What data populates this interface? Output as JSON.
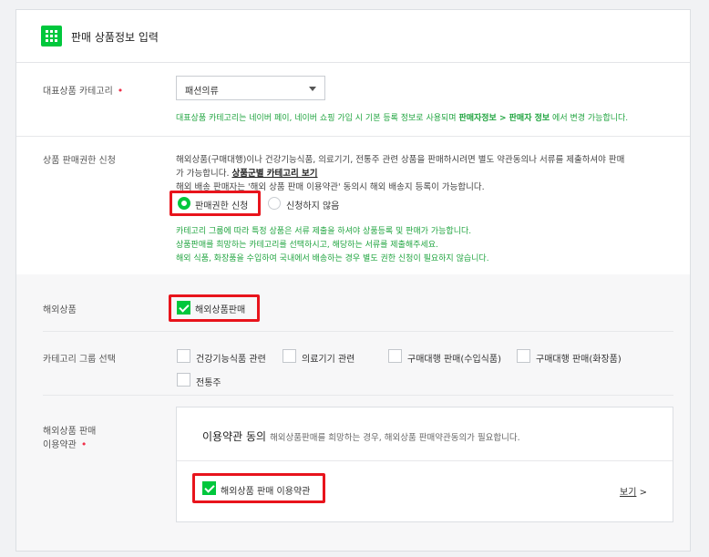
{
  "header": {
    "title": "판매 상품정보 입력",
    "icon": "grid-icon"
  },
  "category": {
    "label": "대표상품 카테고리",
    "required_mark": "•",
    "selected": "패션의류",
    "note_prefix": "대표상품 카테고리는 네이버 페이, 네이버 쇼핑 가입 시 기본 등록 정보로 사용되며 ",
    "note_bold": "판매자정보 > 판매자 정보",
    "note_suffix": " 에서 변경 가능합니다."
  },
  "permission": {
    "label": "상품 판매권한 신청",
    "desc_line1": "해외상품(구매대행)이나 건강기능식품, 의료기기, 전통주 관련 상품을 판매하시려면 별도 약관동의나 서류를 제출하셔야 판매",
    "desc_line2_prefix": "가 가능합니다. ",
    "desc_link": "상품군별 카테고리 보기",
    "desc_line3": "해외 배송 판매자는 '해외 상품 판매 이용약관' 동의시 해외 배송지 등록이 가능합니다.",
    "option_apply": "판매권한 신청",
    "option_no_apply": "신청하지 않음",
    "selected": "판매권한 신청",
    "note1": "카테고리 그룹에 따라 특정 상품은 서류 제출을 하셔야 상품등록 및 판매가 가능합니다.",
    "note2": "상품판매를 희망하는 카테고리를 선택하시고, 해당하는 서류를 제출해주세요.",
    "note3": "해외 식품, 화장품을 수입하여 국내에서 배송하는 경우 별도 권한 신청이 필요하지 않습니다."
  },
  "overseas": {
    "label": "해외상품",
    "checkbox_label": "해외상품판매",
    "checked": true
  },
  "category_group": {
    "label": "카테고리 그룹 선택",
    "options": [
      {
        "label": "건강기능식품 관련",
        "checked": false
      },
      {
        "label": "의료기기 관련",
        "checked": false
      },
      {
        "label": "구매대행 판매(수입식품)",
        "checked": false
      },
      {
        "label": "구매대행 판매(화장품)",
        "checked": false
      },
      {
        "label": "전통주",
        "checked": false
      }
    ]
  },
  "terms": {
    "label_line1": "해외상품 판매",
    "label_line2": "이용약관",
    "required_mark": "•",
    "title": "이용약관 동의",
    "subtitle": "해외상품판매를 희망하는 경우, 해외상품 판매약관동의가 필요합니다.",
    "agree_label": "해외상품 판매 이용약관",
    "agreed": true,
    "view_label": "보기",
    "view_arrow": ">"
  },
  "colors": {
    "accent": "#00c73c",
    "note_green": "#22a541",
    "highlight_red": "#e8141c",
    "required_red": "#f0304a"
  }
}
